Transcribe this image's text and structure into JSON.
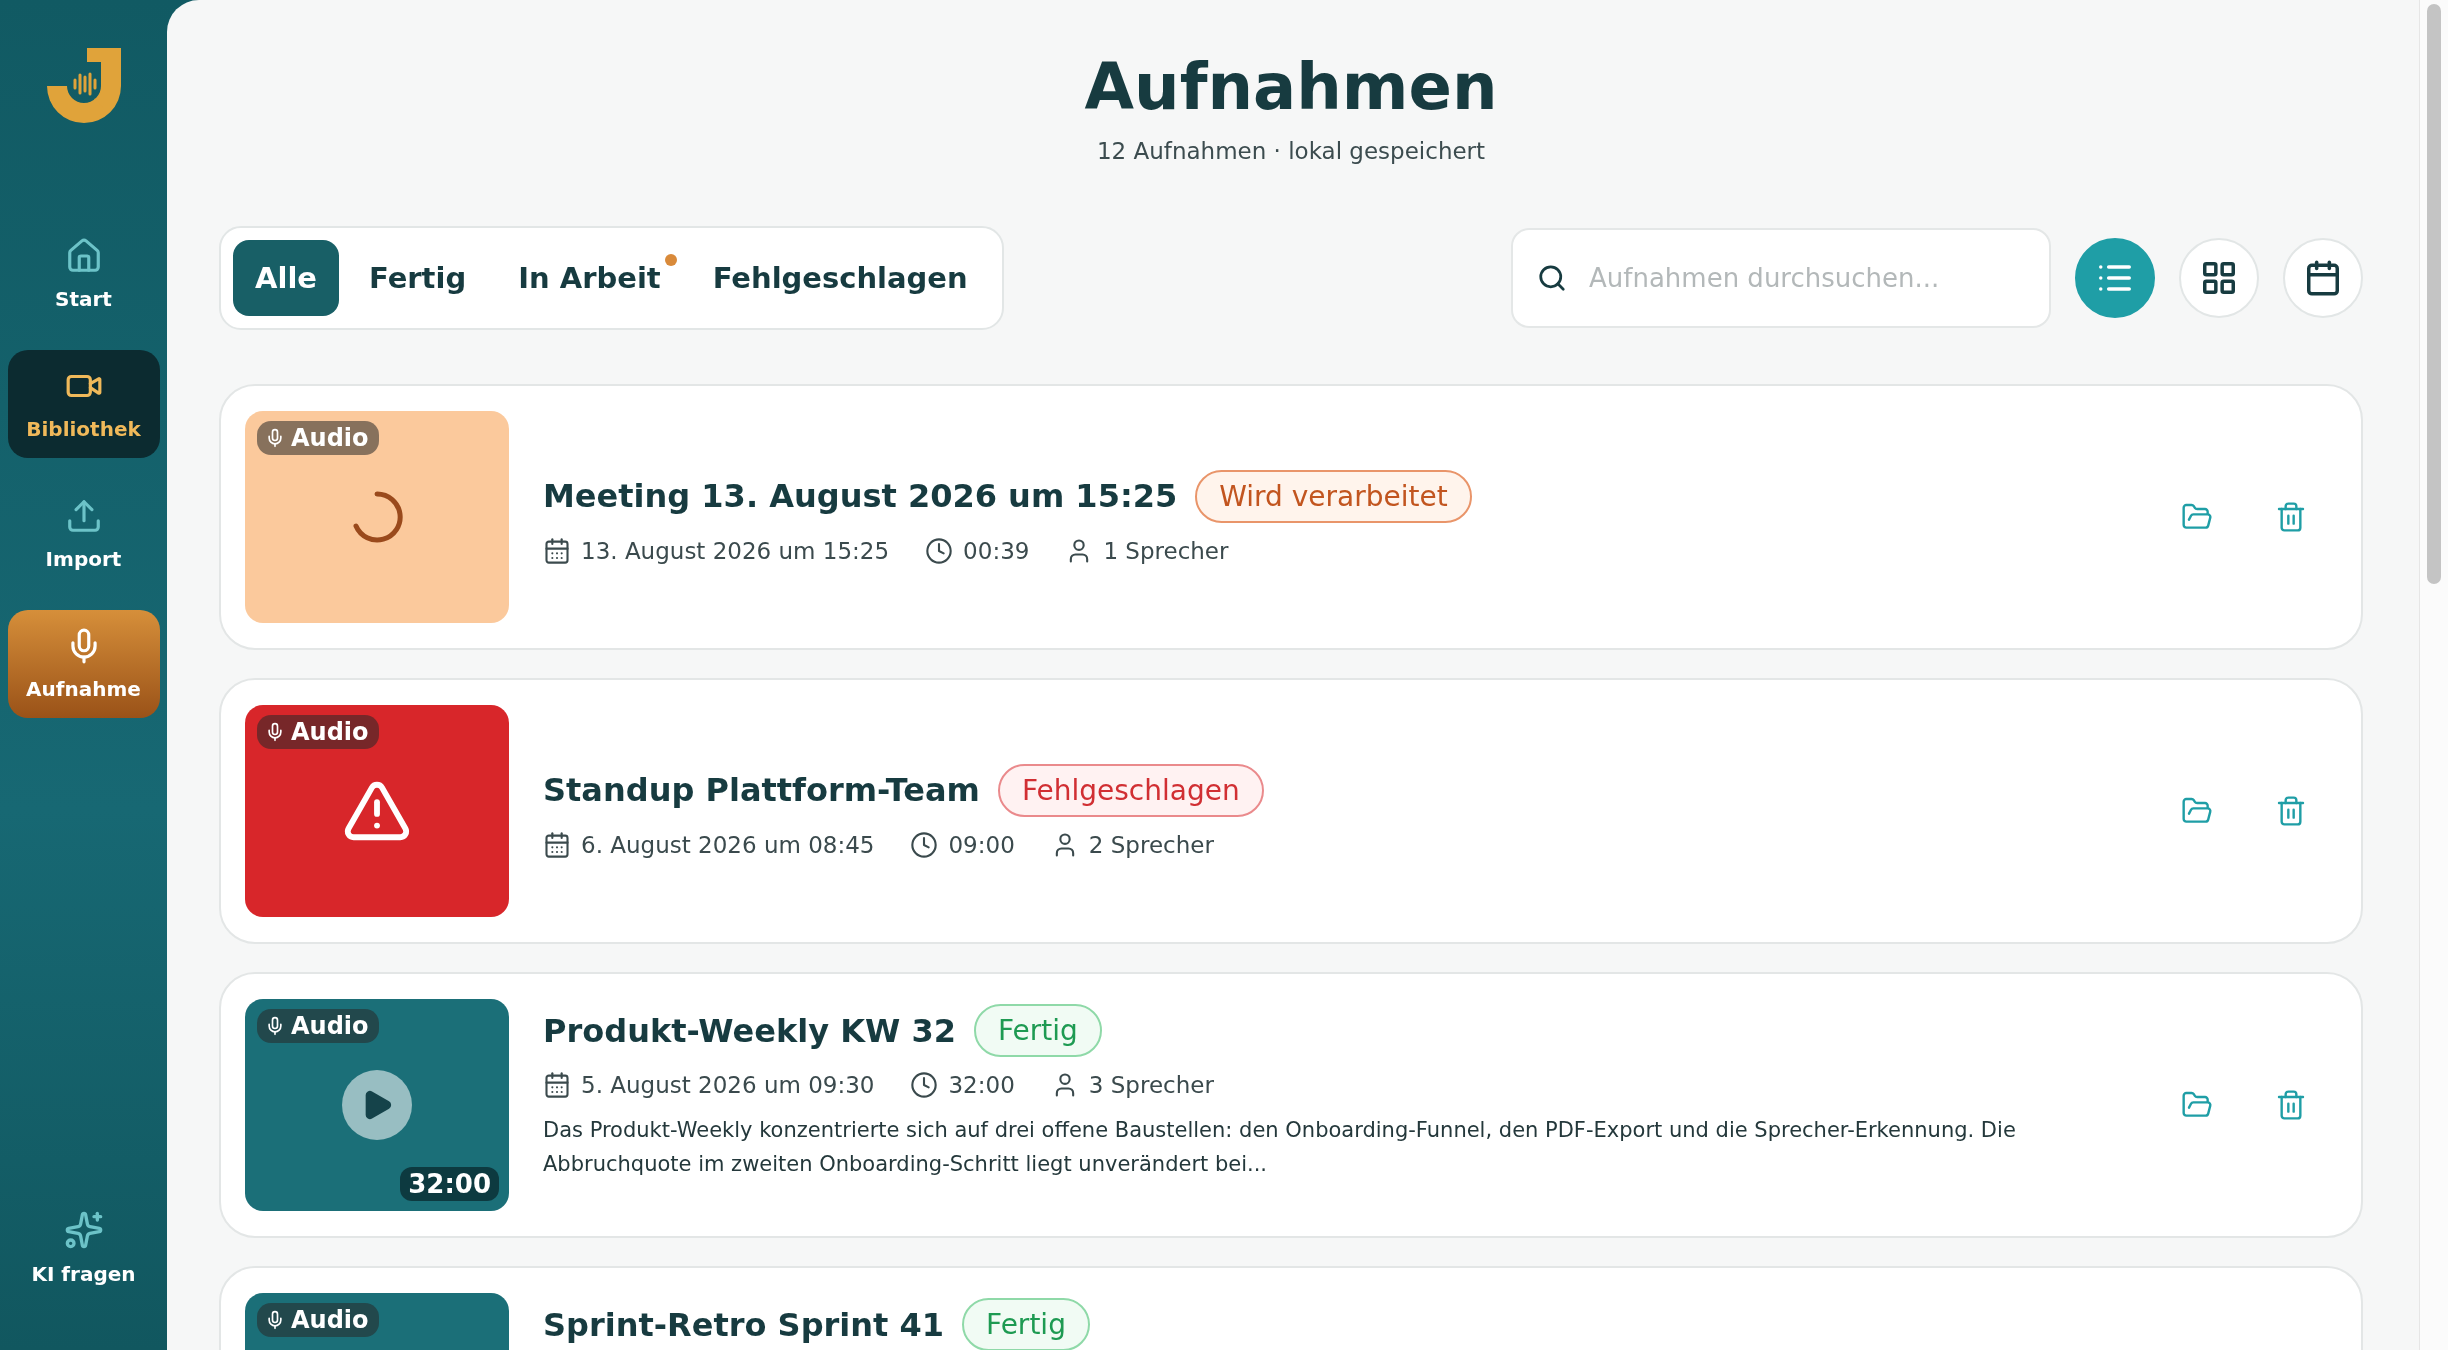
{
  "sidebar": {
    "items": [
      {
        "label": "Start",
        "kind": "nav",
        "selected": false
      },
      {
        "label": "Bibliothek",
        "kind": "nav",
        "selected": true
      },
      {
        "label": "Import",
        "kind": "nav",
        "selected": false
      },
      {
        "label": "Aufnahme",
        "kind": "accent",
        "selected": false
      }
    ],
    "bottom_item": {
      "label": "KI fragen"
    }
  },
  "header": {
    "title": "Aufnahmen",
    "subtitle": "12 Aufnahmen · lokal gespeichert"
  },
  "tabs": [
    {
      "label": "Alle",
      "selected": true,
      "notification": false
    },
    {
      "label": "Fertig",
      "selected": false,
      "notification": false
    },
    {
      "label": "In Arbeit",
      "selected": false,
      "notification": true
    },
    {
      "label": "Fehlgeschlagen",
      "selected": false,
      "notification": false
    }
  ],
  "search": {
    "placeholder": "Aufnahmen durchsuchen..."
  },
  "views": [
    {
      "kind": "list",
      "selected": true
    },
    {
      "kind": "grid",
      "selected": false
    },
    {
      "kind": "calendar",
      "selected": false
    }
  ],
  "recordings": [
    {
      "type_label": "Audio",
      "kind": "processing",
      "title": "Meeting 13. August 2026 um 15:25",
      "badge": "Wird verarbeitet",
      "date": "13. August 2026 um 15:25",
      "duration": "00:39",
      "speakers": "1 Sprecher"
    },
    {
      "type_label": "Audio",
      "kind": "failed",
      "title": "Standup Plattform-Team",
      "badge": "Fehlgeschlagen",
      "date": "6. August 2026 um 08:45",
      "duration": "09:00",
      "speakers": "2 Sprecher"
    },
    {
      "type_label": "Audio",
      "kind": "done",
      "title": "Produkt-Weekly KW 32",
      "badge": "Fertig",
      "date": "5. August 2026 um 09:30",
      "duration": "32:00",
      "speakers": "3 Sprecher",
      "thumb_duration": "32:00",
      "summary": "Das Produkt-Weekly konzentrierte sich auf drei offene Baustellen: den Onboarding-Funnel, den PDF-Export und die Sprecher-Erkennung. Die Abbruchquote im zweiten Onboarding-Schritt liegt unverändert bei..."
    },
    {
      "type_label": "Audio",
      "kind": "done",
      "title": "Sprint-Retro Sprint 41",
      "badge": "Fertig"
    }
  ]
}
